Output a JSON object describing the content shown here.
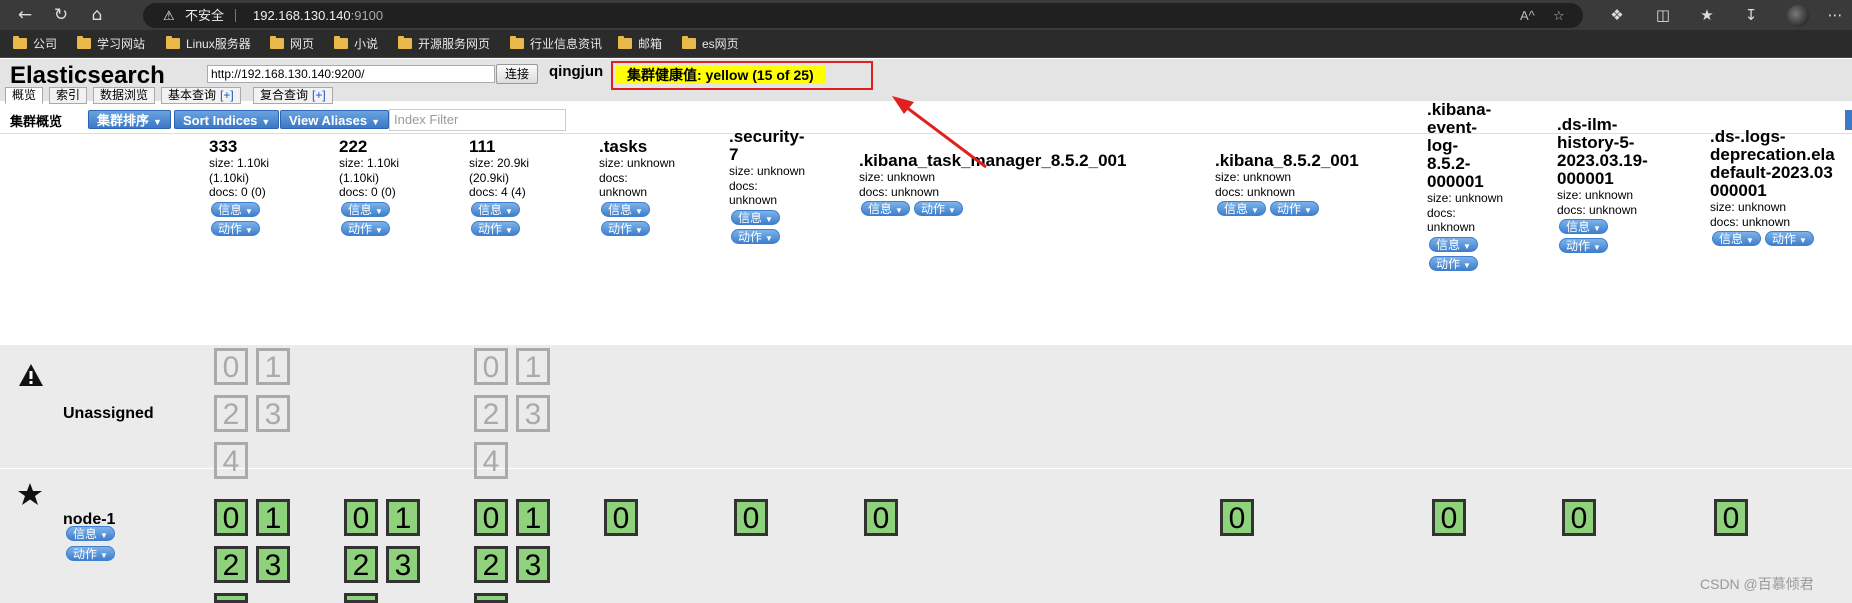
{
  "browser": {
    "security_label": "不安全",
    "url_host": "192.168.130.140",
    "url_port": ":9100",
    "reader_icon": "A^",
    "bookmarks": [
      "公司",
      "学习网站",
      "Linux服务器",
      "网页",
      "小说",
      "开源服务网页",
      "行业信息资讯",
      "邮箱",
      "es网页"
    ]
  },
  "app": {
    "brand": "Elasticsearch",
    "connect_url": "http://192.168.130.140:9200/",
    "connect_button": "连接",
    "cluster_name": "qingjun",
    "health": "集群健康值: yellow (15 of 25)",
    "tabs": [
      "概览",
      "索引",
      "数据浏览",
      "基本查询",
      "复合查询"
    ],
    "tab_plus": "[+]",
    "overview_title": "集群概览",
    "sort_button": "集群排序",
    "sort_indices_button": "Sort Indices",
    "view_aliases_button": "View Aliases",
    "index_filter_placeholder": "Index Filter",
    "info_label": "信息",
    "action_label": "动作",
    "accent_color": "#3f7fcc",
    "health_color": "#ffff00"
  },
  "indices": [
    {
      "name": "333",
      "size": "size: 1.10ki",
      "size2": "(1.10ki)",
      "docs": "docs: 0 (0)"
    },
    {
      "name": "222",
      "size": "size: 1.10ki",
      "size2": "(1.10ki)",
      "docs": "docs: 0 (0)"
    },
    {
      "name": "111",
      "size": "size: 20.9ki",
      "size2": "(20.9ki)",
      "docs": "docs: 4 (4)"
    },
    {
      "name": ".tasks",
      "size": "size: unknown",
      "size2": "docs:",
      "docs": "unknown"
    },
    {
      "name": ".security-\n7",
      "size": "size: unknown",
      "size2": "docs:",
      "docs": "unknown"
    },
    {
      "name": ".kibana_task_manager_8.5.2_001",
      "size": "size: unknown",
      "size2": "docs: unknown",
      "docs": ""
    },
    {
      "name": ".kibana_8.5.2_001",
      "size": "size: unknown",
      "size2": "docs: unknown",
      "docs": ""
    },
    {
      "name": ".kibana-\nevent-\nlog-\n8.5.2-\n000001",
      "size": "size: unknown",
      "size2": "docs:",
      "docs": "unknown"
    },
    {
      "name": ".ds-ilm-\nhistory-5-\n2023.03.19-\n000001",
      "size": "size: unknown",
      "size2": "docs: unknown",
      "docs": ""
    },
    {
      "name": ".ds-.logs-\ndeprecation.ela\ndefault-2023.03\n000001",
      "size": "size: unknown",
      "size2": "docs: unknown",
      "docs": ""
    }
  ],
  "rows": {
    "unassigned_label": "Unassigned",
    "node_label": "node-1",
    "unassigned_shards": {
      "333": [
        "0",
        "1",
        "2",
        "3",
        "4"
      ],
      "111": [
        "0",
        "1",
        "2",
        "3",
        "4"
      ]
    },
    "node_shards": [
      "0",
      "1",
      "2",
      "3"
    ],
    "single_shard": "0"
  },
  "watermark": "CSDN @百慕倾君"
}
